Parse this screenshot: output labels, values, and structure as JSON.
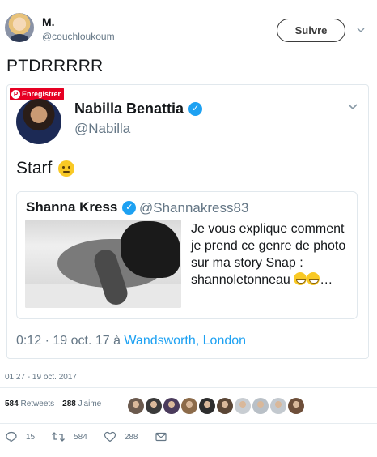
{
  "author": {
    "name": "M.",
    "handle": "@couchloukoum"
  },
  "follow_label": "Suivre",
  "tweet_text": "PTDRRRRR",
  "quoted": {
    "pin_label": "Enregistrer",
    "name": "Nabilla Benattia",
    "handle": "@Nabilla",
    "text": "Starf",
    "inner": {
      "name": "Shanna Kress",
      "handle": "@Shannakress83",
      "text": "Je vous explique comment je prend ce genre de photo sur ma story Snap : shannoletonneau",
      "ellipsis": "…"
    },
    "meta_time": "0:12 · 19 oct. 17 à ",
    "meta_location": "Wandsworth, London"
  },
  "timestamp": "01:27 - 19 oct. 2017",
  "stats": {
    "retweets_count": "584",
    "retweets_label": "Retweets",
    "likes_count": "288",
    "likes_label": "J'aime"
  },
  "liker_colors": [
    "#6b5a4e",
    "#3a3a3a",
    "#4a3b5c",
    "#8c6b4a",
    "#2d2d2d",
    "#5a4636",
    "#c8cdd2",
    "#b9c0c7",
    "#c3c9cf",
    "#6e4f3a"
  ],
  "actions": {
    "replies": "15",
    "retweets": "584",
    "likes": "288"
  },
  "colors": {
    "accent": "#1da1f2",
    "muted": "#657786",
    "text": "#14171a",
    "pinterest": "#e60023"
  }
}
